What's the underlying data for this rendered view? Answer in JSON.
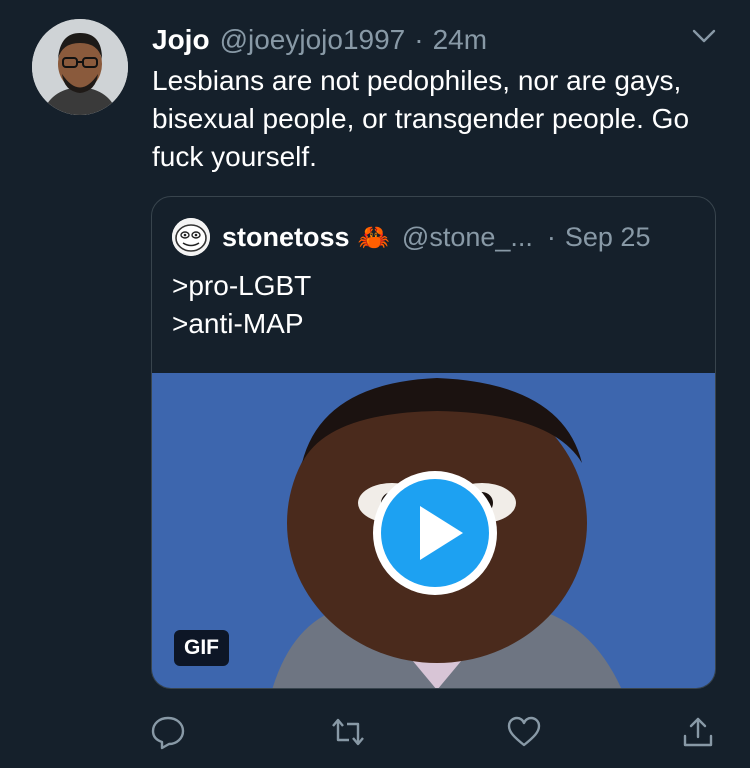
{
  "tweet": {
    "author_name": "Jojo",
    "author_handle": "@joeyjojo1997",
    "separator": "·",
    "time": "24m",
    "text": "Lesbians are not pedophiles, nor are gays, bisexual people, or transgender people. Go fuck yourself."
  },
  "quoted": {
    "author_name": "stonetoss",
    "emoji": "🦀",
    "author_handle": "@stone_...",
    "separator": "·",
    "time": "Sep 25",
    "line1": ">pro-LGBT",
    "line2": ">anti-MAP",
    "media_badge": "GIF"
  },
  "actions": {
    "icons": [
      "reply-icon",
      "retweet-icon",
      "like-icon",
      "share-icon"
    ]
  },
  "colors": {
    "background": "#15202b",
    "secondary_text": "#8899a6",
    "border": "#38444d",
    "accent": "#1da1f2"
  }
}
